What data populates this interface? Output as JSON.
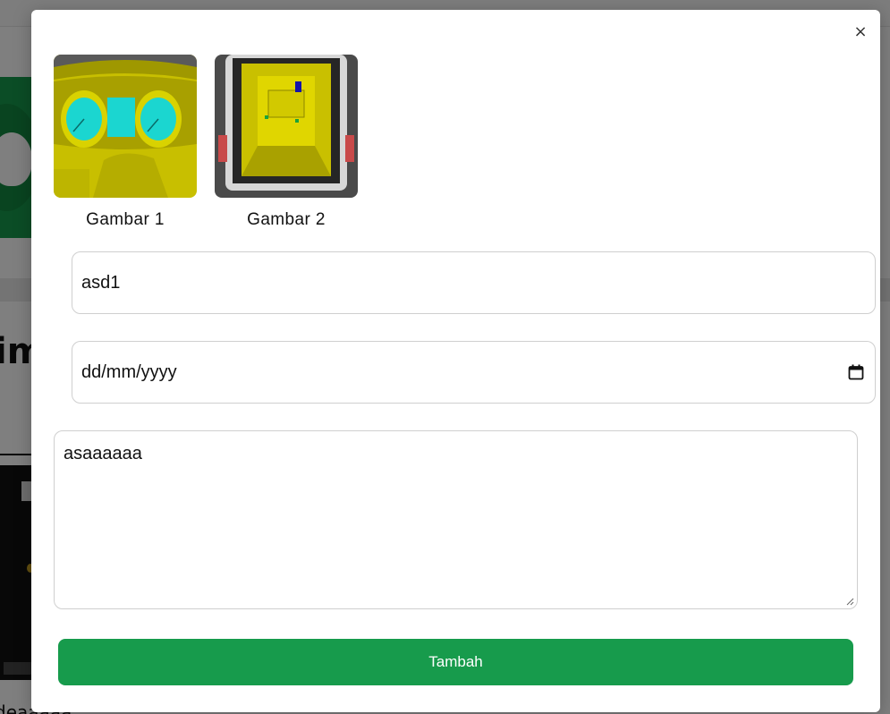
{
  "background_page": {
    "heading_fragment": "im",
    "footer_fragment": "deaaaaa"
  },
  "modal": {
    "close_label": "×",
    "images": [
      {
        "caption": "Gambar 1",
        "icon": "car-dashboard-image"
      },
      {
        "caption": "Gambar 2",
        "icon": "van-interior-image"
      }
    ],
    "name_value": "asd1",
    "date_placeholder": "dd/mm/yyyy",
    "notes_value": "asaaaaaa",
    "submit_label": "Tambah"
  },
  "colors": {
    "accent": "#179b4c",
    "overlay": "rgba(0,0,0,0.5)",
    "border": "#cfcfcf"
  }
}
